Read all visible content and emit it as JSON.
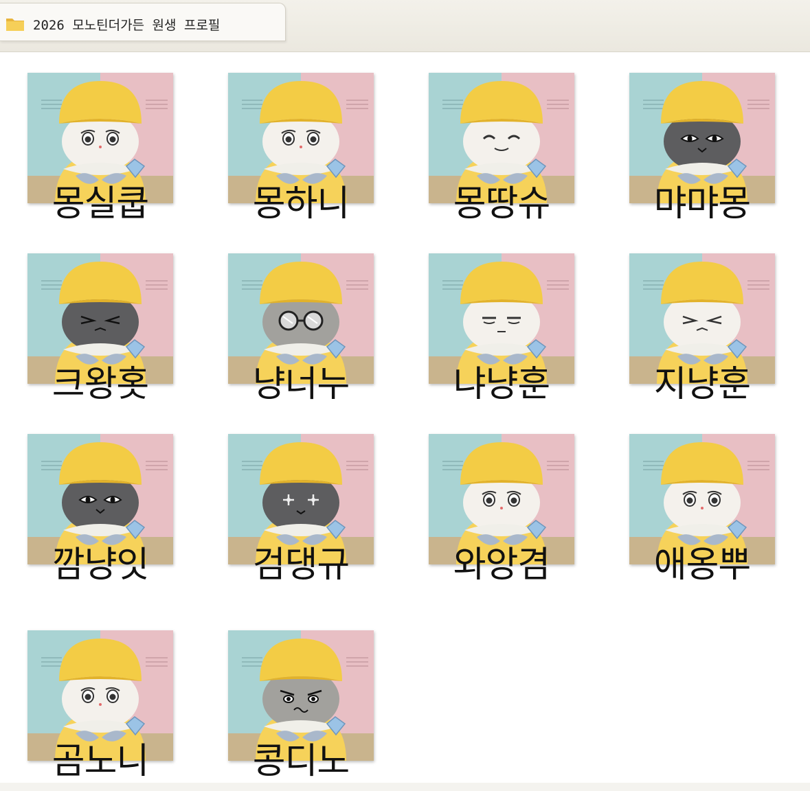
{
  "window": {
    "folder_icon": "folder-icon",
    "title": "2026 모노틴더가든 원생 프로필"
  },
  "items": [
    {
      "name": "몽실쿱",
      "face": "white",
      "ears": "none",
      "eyes": "girl"
    },
    {
      "name": "몽하니",
      "face": "white",
      "ears": "none",
      "eyes": "girl"
    },
    {
      "name": "몽땅슈",
      "face": "white",
      "ears": "none",
      "eyes": "smile"
    },
    {
      "name": "먀먀몽",
      "face": "dark",
      "ears": "cat",
      "eyes": "cat"
    },
    {
      "name": "크왕홋",
      "face": "dark",
      "ears": "none",
      "eyes": "squint"
    },
    {
      "name": "냥너누",
      "face": "grey",
      "ears": "none",
      "eyes": "glasses"
    },
    {
      "name": "냐냥훈",
      "face": "white",
      "ears": "none",
      "eyes": "sleepy"
    },
    {
      "name": "지냥훈",
      "face": "white",
      "ears": "none",
      "eyes": "squint"
    },
    {
      "name": "깜냥잇",
      "face": "dark",
      "ears": "cat",
      "eyes": "cat"
    },
    {
      "name": "검댕규",
      "face": "dark",
      "ears": "bear",
      "eyes": "star"
    },
    {
      "name": "와앙겸",
      "face": "white",
      "ears": "patch",
      "eyes": "girl"
    },
    {
      "name": "애옹뿌",
      "face": "white",
      "ears": "cat",
      "eyes": "girl"
    },
    {
      "name": "곰노니",
      "face": "white",
      "ears": "none",
      "eyes": "girl"
    },
    {
      "name": "콩디노",
      "face": "grey",
      "ears": "none",
      "eyes": "grumpy"
    }
  ],
  "colors": {
    "hat": "#f3cc45",
    "hat_shade": "#e2b22a",
    "scarf": "#f0efe9",
    "body": "#f6d25a",
    "mittens": "#a9b8cb",
    "diamond": "#9bc3e6",
    "wall_left": "#a9d3d3",
    "wall_right": "#e8bfc4",
    "floor": "#c9b48d",
    "face_white": "#f4f1ec",
    "face_grey": "#a2a19d",
    "face_dark": "#5d5d5f"
  }
}
